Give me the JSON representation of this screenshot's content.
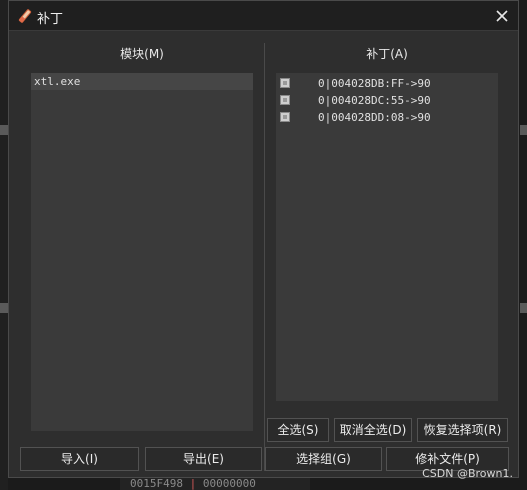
{
  "dialog": {
    "title": "补丁",
    "close_icon": "close-icon",
    "title_icon": "patch-brush-icon"
  },
  "modules": {
    "title": "模块(M)",
    "items": [
      "xtl.exe"
    ],
    "import_label": "导入(I)",
    "export_label": "导出(E)"
  },
  "patches": {
    "title": "补丁(A)",
    "items": [
      "0|004028DB:FF->90",
      "0|004028DC:55->90",
      "0|004028DD:08->90"
    ],
    "select_all_label": "全选(S)",
    "deselect_all_label": "取消全选(D)",
    "restore_selection_label": "恢复选择项(R)",
    "select_group_label": "选择组(G)",
    "patch_file_label": "修补文件(P)"
  },
  "background": {
    "bottom_text_a": "0015F498",
    "bottom_text_b": "00000000"
  },
  "watermark": "CSDN @Brown1.",
  "colors": {
    "dialog_bg": "#2e2e2e",
    "list_bg": "#3a3a3a",
    "selected_bg": "#464646",
    "title_bar_bg": "#1f1f1f"
  }
}
